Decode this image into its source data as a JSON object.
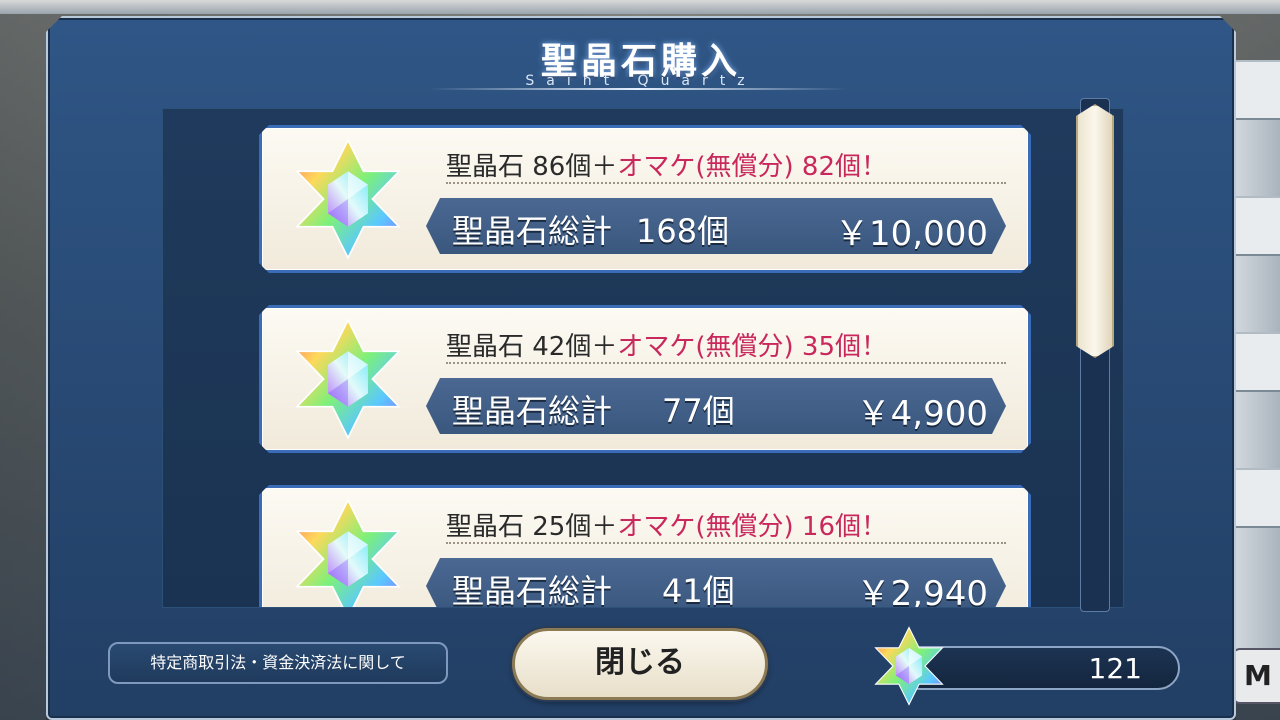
{
  "dialog": {
    "title": "聖晶石購入",
    "subtitle": "Saint Quartz"
  },
  "products": [
    {
      "base_label": "聖晶石 86個＋",
      "bonus_label": "オマケ(無償分)",
      "bonus_count": " 82個！",
      "total_label": "聖晶石総計",
      "total_count": "168個",
      "price": "￥10,000"
    },
    {
      "base_label": "聖晶石 42個＋",
      "bonus_label": "オマケ(無償分)",
      "bonus_count": " 35個！",
      "total_label": "聖晶石総計",
      "total_count": "77個",
      "price": "￥4,900"
    },
    {
      "base_label": "聖晶石 25個＋",
      "bonus_label": "オマケ(無償分)",
      "bonus_count": " 16個！",
      "total_label": "聖晶石総計",
      "total_count": "41個",
      "price": "￥2,940"
    }
  ],
  "footer": {
    "legal_label": "特定商取引法・資金決済法に関して",
    "close_label": "閉じる",
    "quartz_count": "121"
  },
  "colors": {
    "dialog_bg": "#2a4c78",
    "card_bg": "#f6f1e6",
    "card_border": "#3a6cb8",
    "bonus_text": "#c8285b",
    "total_bar": "#44628c"
  },
  "icons": {
    "quartz": "saint-quartz-icon"
  }
}
